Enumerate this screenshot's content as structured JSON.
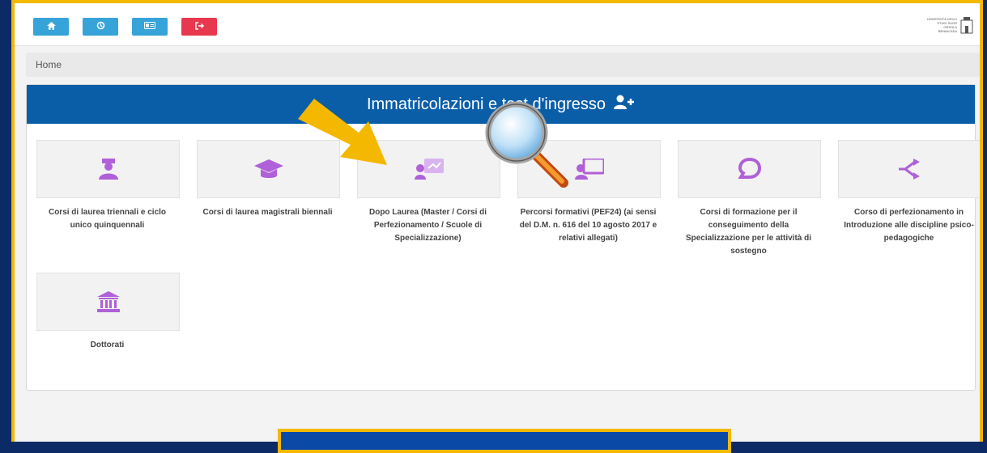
{
  "topbar": {
    "buttons": [
      {
        "name": "home-button",
        "icon": "home-icon",
        "color": "#36a3d9"
      },
      {
        "name": "history-button",
        "icon": "history-icon",
        "color": "#36a3d9"
      },
      {
        "name": "card-button",
        "icon": "id-card-icon",
        "color": "#36a3d9"
      },
      {
        "name": "logout-button",
        "icon": "logout-icon",
        "color": "#e8384f"
      }
    ],
    "logo_text": "UNIVERSITÀ DEGLI STUDI SUOR ORSOLA BENINCASA"
  },
  "breadcrumb": {
    "label": "Home"
  },
  "panel": {
    "title": "Immatricolazioni e test d'ingresso",
    "title_icon": "user-plus-icon",
    "accent_color": "#0a5ea8",
    "icon_color": "#b060d8"
  },
  "tiles": [
    {
      "icon": "graduate-icon",
      "label": "Corsi di laurea triennali e ciclo unico quinquennali"
    },
    {
      "icon": "graduation-cap-icon",
      "label": "Corsi di laurea magistrali biennali"
    },
    {
      "icon": "teacher-board-icon",
      "label": "Dopo Laurea (Master / Corsi di Perfezionamento / Scuole di Specializzazione)"
    },
    {
      "icon": "presenter-icon",
      "label": "Percorsi formativi (PEF24) (ai sensi del D.M. n. 616 del 10 agosto 2017 e relativi allegati)"
    },
    {
      "icon": "chat-bubble-icon",
      "label": "Corsi di formazione per il conseguimento della Specializzazione per le attività di sostegno"
    },
    {
      "icon": "share-arrows-icon",
      "label": "Corso di perfezionamento in Introduzione alle discipline psico-pedagogiche"
    },
    {
      "icon": "institution-icon",
      "label": "Dottorati"
    }
  ]
}
